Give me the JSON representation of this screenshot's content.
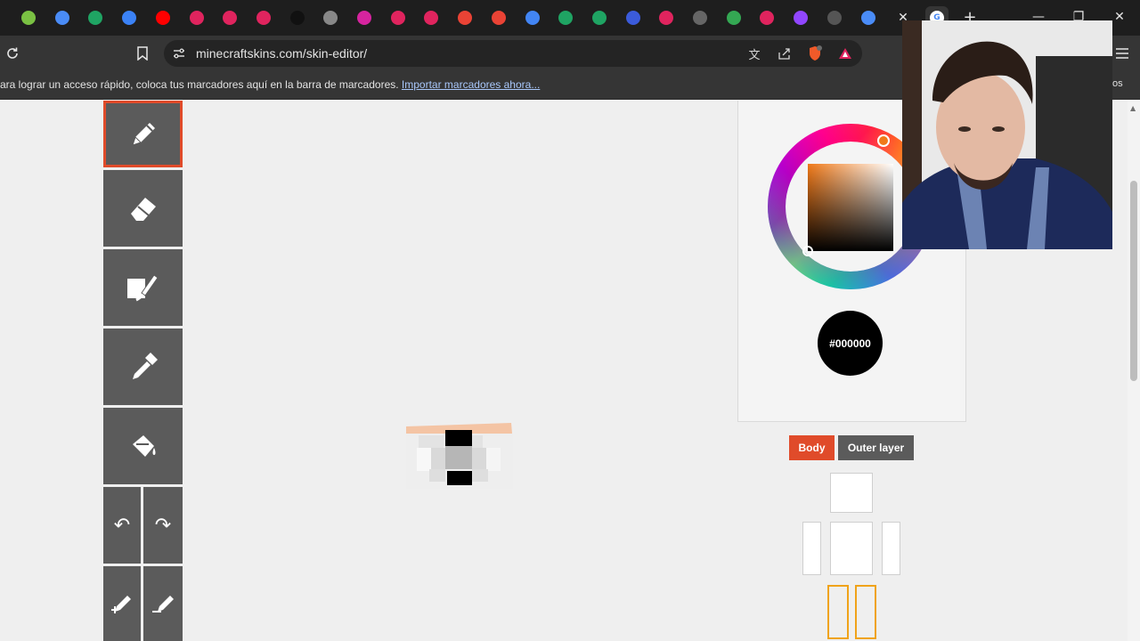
{
  "browser": {
    "tabs": [
      {
        "icon": "app-icon",
        "color": "#7ac143"
      },
      {
        "icon": "gemini-icon",
        "color": "#4a8cf7"
      },
      {
        "icon": "drive-icon",
        "color": "#1fa463"
      },
      {
        "icon": "app-icon",
        "color": "#3b82f6"
      },
      {
        "icon": "youtube-icon",
        "color": "#ff0000"
      },
      {
        "icon": "youtube-icon",
        "color": "#e0245e"
      },
      {
        "icon": "youtube-icon",
        "color": "#e0245e"
      },
      {
        "icon": "gmail-icon",
        "color": "#e0245e"
      },
      {
        "icon": "tiktok-icon",
        "color": "#111111"
      },
      {
        "icon": "app-icon",
        "color": "#888888"
      },
      {
        "icon": "instagram-icon",
        "color": "#d6249f"
      },
      {
        "icon": "app-icon",
        "color": "#e0245e"
      },
      {
        "icon": "app-icon",
        "color": "#e0245e"
      },
      {
        "icon": "gmail-icon",
        "color": "#ea4335"
      },
      {
        "icon": "gmail-icon",
        "color": "#ea4335"
      },
      {
        "icon": "google-icon",
        "color": "#4285f4"
      },
      {
        "icon": "drive-icon",
        "color": "#1fa463"
      },
      {
        "icon": "drive-icon",
        "color": "#1fa463"
      },
      {
        "icon": "app-icon",
        "color": "#3b5bdb"
      },
      {
        "icon": "app-icon",
        "color": "#e0245e"
      },
      {
        "icon": "loading-icon",
        "color": "#666666"
      },
      {
        "icon": "maps-icon",
        "color": "#34a853"
      },
      {
        "icon": "app-icon",
        "color": "#e0245e"
      },
      {
        "icon": "twitch-icon",
        "color": "#9146ff"
      },
      {
        "icon": "app-icon",
        "color": "#555555"
      },
      {
        "icon": "app-icon",
        "color": "#4a8cf7"
      }
    ],
    "close_tab_glyph": "✕",
    "new_tab_glyph": "+",
    "window": {
      "minimize": "—",
      "restore": "❐",
      "close": "✕"
    }
  },
  "toolbar": {
    "url": "minecraftskins.com/skin-editor/"
  },
  "bookmarks": {
    "prompt": "ara lograr un acceso rápido, coloca tus marcadores aquí en la barra de marcadores.",
    "import_link": "Importar marcadores ahora...",
    "right_text": "tos"
  },
  "editor": {
    "tools": [
      {
        "name": "pencil-tool",
        "icon": "pencil-icon",
        "active": true
      },
      {
        "name": "eraser-tool",
        "icon": "eraser-icon",
        "active": false
      },
      {
        "name": "brush-tool",
        "icon": "brush-icon",
        "active": false
      },
      {
        "name": "eyedropper-tool",
        "icon": "eyedropper-icon",
        "active": false
      },
      {
        "name": "bucket-tool",
        "icon": "bucket-icon",
        "active": false
      }
    ],
    "undo_glyph": "↶",
    "redo_glyph": "↷",
    "accent": "#e04b2a"
  },
  "color_picker": {
    "hex": "#000000",
    "swatch_color": "#000000"
  },
  "layers": {
    "body_label": "Body",
    "outer_label": "Outer layer",
    "body_color": "#e04b2a",
    "outer_color": "#5b5b5b"
  },
  "parts": {
    "selected_color": "#f0a31a"
  }
}
